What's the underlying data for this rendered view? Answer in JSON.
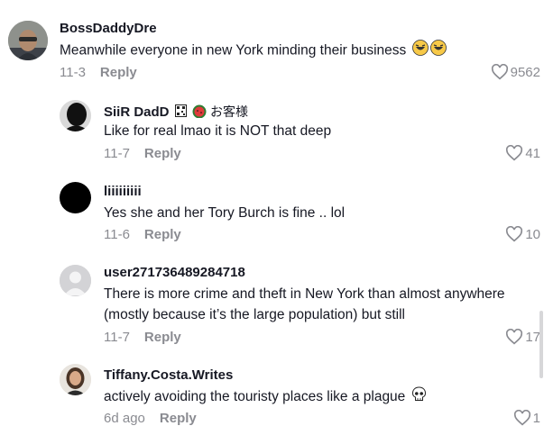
{
  "comments": [
    {
      "username": "BossDaddyDre",
      "text": "Meanwhile everyone in new York minding their business",
      "emoji": [
        "rolling-laughing-emoji",
        "rolling-laughing-emoji"
      ],
      "date": "11-3",
      "reply": "Reply",
      "likes": "9562",
      "avatar": "avatar-photo-man-glasses"
    },
    {
      "username": "SiiR DadD",
      "suffix": "お客様",
      "text": "Like for real lmao it is NOT that deep",
      "date": "11-7",
      "reply": "Reply",
      "likes": "41",
      "avatar": "avatar-dark-silhouette"
    },
    {
      "username": "liiiiiiiii",
      "text": "Yes she and her Tory Burch is fine .. lol",
      "date": "11-6",
      "reply": "Reply",
      "likes": "10",
      "avatar": "avatar-black-circle"
    },
    {
      "username": "user271736489284718",
      "text_line1": "There is more crime and theft in New York than almost anywhere",
      "text_line2": "(mostly because it’s the large population) but still",
      "date": "11-7",
      "reply": "Reply",
      "likes": "17",
      "avatar": "avatar-default-gray"
    },
    {
      "username": "Tiffany.Costa.Writes",
      "text": "actively avoiding the touristy places like a plague",
      "emoji": [
        "skull-emoji"
      ],
      "date": "6d ago",
      "reply": "Reply",
      "likes": "1",
      "avatar": "avatar-photo-woman"
    }
  ],
  "colors": {
    "text": "#161823",
    "muted": "#8a8b91"
  }
}
